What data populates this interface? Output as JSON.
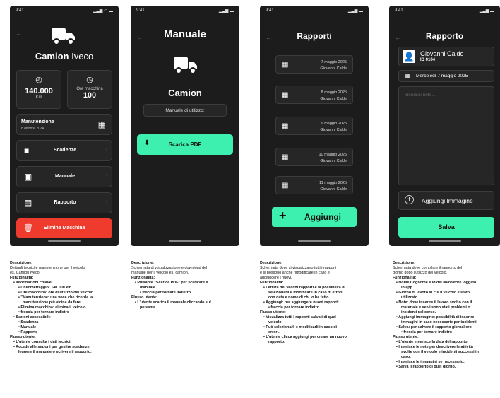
{
  "screens": [
    {
      "time": "9:41",
      "title_main": "Camion",
      "title_sub": " Iveco",
      "km_value": "140.000",
      "km_unit": "Km",
      "hours_label": "Ore macchina",
      "hours_value": "100",
      "maint_title": "Manutenzione",
      "maint_date": "8 ottobre 2024",
      "menu": [
        "Scadenze",
        "Manuale",
        "Rapporto"
      ],
      "delete_label": "Elimina Macchina"
    },
    {
      "time": "9:41",
      "title": "Manuale",
      "vehicle": "Camion",
      "manual_label": "Manuale di utilizzo:",
      "download_label": "Scarica PDF"
    },
    {
      "time": "9:41",
      "title": "Rapporti",
      "reports": [
        {
          "date": "7 maggio 2025",
          "name": "Giovanni Calde"
        },
        {
          "date": "8 maggio 2025",
          "name": "Giovanni Calde"
        },
        {
          "date": "9 maggio 2025",
          "name": "Giovanni Calde"
        },
        {
          "date": "10 maggio 2025",
          "name": "Giovanni Calde"
        },
        {
          "date": "11 maggio 2025",
          "name": "Giovanni Calde"
        }
      ],
      "add_label": "Aggiungi"
    },
    {
      "time": "9:41",
      "title": "Rapporto",
      "worker_name": "Giovanni Calde",
      "worker_id": "ID 0104",
      "date": "Mercoledì 7 maggio 2025",
      "notes_placeholder": "Inserisci note....",
      "add_image_label": "Aggiungi Immagine",
      "save_label": "Salva"
    }
  ],
  "descriptions": [
    [
      {
        "c": "b",
        "t": "Descrizione:"
      },
      {
        "c": "",
        "t": "Dettagli tecnici e manutenzione per il veicolo"
      },
      {
        "c": "",
        "t": "es. Camion Iveco."
      },
      {
        "c": "b",
        "t": "Funzionalità:"
      },
      {
        "c": "b l1",
        "t": "• Informazioni chiave:"
      },
      {
        "c": "b l2",
        "t": "• Chilometraggio: 140.000 km"
      },
      {
        "c": "b l2",
        "t": "• Ore macchina: ore di utilizzo del veicolo."
      },
      {
        "c": "b l2",
        "t": "• \"Manutenzione: una voce che ricorda la"
      },
      {
        "c": "b l3",
        "t": "manutenzione più vicina da fare."
      },
      {
        "c": "b l2",
        "t": "• Elimina macchina: elimina il veicolo"
      },
      {
        "c": "b l2",
        "t": "• freccia per tornare indietro"
      },
      {
        "c": "b l1",
        "t": "• Sezioni accessibili:"
      },
      {
        "c": "b l2",
        "t": "• Scadenza"
      },
      {
        "c": "b l2",
        "t": "• Manuale"
      },
      {
        "c": "b l2",
        "t": "• Rapporto"
      },
      {
        "c": "b",
        "t": "Flusso utente:"
      },
      {
        "c": "b l1",
        "t": "• L'utente consulta i dati tecnici."
      },
      {
        "c": "b l1",
        "t": "• Accede alle sezioni per gestire scadenze,"
      },
      {
        "c": "b l2",
        "t": "leggere il manuale o scrivere il rapporto."
      }
    ],
    [
      {
        "c": "b",
        "t": "Descrizione:"
      },
      {
        "c": "",
        "t": "Schermata di visualizzazione e download del"
      },
      {
        "c": "",
        "t": "manuale per il veicolo es. camion."
      },
      {
        "c": "b",
        "t": "Funzionalità:"
      },
      {
        "c": "b l1",
        "t": "• Pulsante \"Scarica PDF\" per scaricare il"
      },
      {
        "c": "b l2",
        "t": "manuale."
      },
      {
        "c": "b l2",
        "t": "• freccia per tornare indietro"
      },
      {
        "c": "b",
        "t": "Flusso utente:"
      },
      {
        "c": "b l1",
        "t": "• L'utente scarica il manuale cliccando sul"
      },
      {
        "c": "b l2",
        "t": "pulsante.."
      }
    ],
    [
      {
        "c": "b",
        "t": "Descrizione:"
      },
      {
        "c": "",
        "t": "Schermata dove si visualizzano tutti i rapporti"
      },
      {
        "c": "",
        "t": "e si possono anche rimodificare in caso e"
      },
      {
        "c": "",
        "t": "aggiungere i nuovi."
      },
      {
        "c": "b",
        "t": "Funzionalità:"
      },
      {
        "c": "b l1",
        "t": "• Lettura dei vecchi rapporti e la possibilità di"
      },
      {
        "c": "b l2",
        "t": "selezionarli e modificarli in caso di errori,"
      },
      {
        "c": "b l2",
        "t": "con data e nome di chi lo ha fatto"
      },
      {
        "c": "b l1",
        "t": "• Aggiungi: per aggiungere nuovi rapporti"
      },
      {
        "c": "b l2",
        "t": "• freccia per tornare indietro"
      },
      {
        "c": "b",
        "t": "Flusso utente:"
      },
      {
        "c": "b l1",
        "t": "• Visualizza tutti i rapporti salvati di quel"
      },
      {
        "c": "b l2",
        "t": "veicolo."
      },
      {
        "c": "b l1",
        "t": "• Può selezionarli e modificarli in caso di"
      },
      {
        "c": "b l2",
        "t": "errori."
      },
      {
        "c": "b l1",
        "t": "• L'utente clicca aggiungi per creare un nuovo"
      },
      {
        "c": "b l2",
        "t": "rapporto."
      }
    ],
    [
      {
        "c": "b",
        "t": "Descrizione:"
      },
      {
        "c": "",
        "t": "Schermata dove compilare il rapporto del"
      },
      {
        "c": "",
        "t": "giorno dopo l'utilizzo del veicolo."
      },
      {
        "c": "b",
        "t": "Funzionalità:"
      },
      {
        "c": "b l1",
        "t": "• Nome,Cognome e id del lavoratore loggato"
      },
      {
        "c": "b l2",
        "t": "in app."
      },
      {
        "c": "b l1",
        "t": "• Giorno di lavoro in cui il veicolo è stato"
      },
      {
        "c": "b l2",
        "t": "utilizzato."
      },
      {
        "c": "b l1",
        "t": "• Note: dove inserire il lavoro svolto con il"
      },
      {
        "c": "b l2",
        "t": "materiale e se vi sono stati problemi o"
      },
      {
        "c": "b l2",
        "t": "incidenti nel corso."
      },
      {
        "c": "b l1",
        "t": "• Aggiungi immagine: possibilità di inserire"
      },
      {
        "c": "b l2",
        "t": "immagini in caso necessarie per incidenti."
      },
      {
        "c": "b l1",
        "t": "• Salva: per salvare il rapporto giornaliero"
      },
      {
        "c": "b l2",
        "t": "• freccia per tornare indietro"
      },
      {
        "c": "b",
        "t": "Flusso utente:"
      },
      {
        "c": "b l1",
        "t": "• L'utente inserisce la data del rapporto"
      },
      {
        "c": "b l1",
        "t": "• Inserisce le note per descrivere le attività"
      },
      {
        "c": "b l2",
        "t": "svolte con il veicolo e incidenti successi in"
      },
      {
        "c": "b l2",
        "t": "caso."
      },
      {
        "c": "b l1",
        "t": "• Inserisce le immagini se necessario."
      },
      {
        "c": "b l1",
        "t": "• Salva il rapporto di quel giorno."
      }
    ]
  ],
  "colors": {
    "accent": "#3ef0b0",
    "danger": "#ee3b2e",
    "bg": "#1c1c1c"
  }
}
